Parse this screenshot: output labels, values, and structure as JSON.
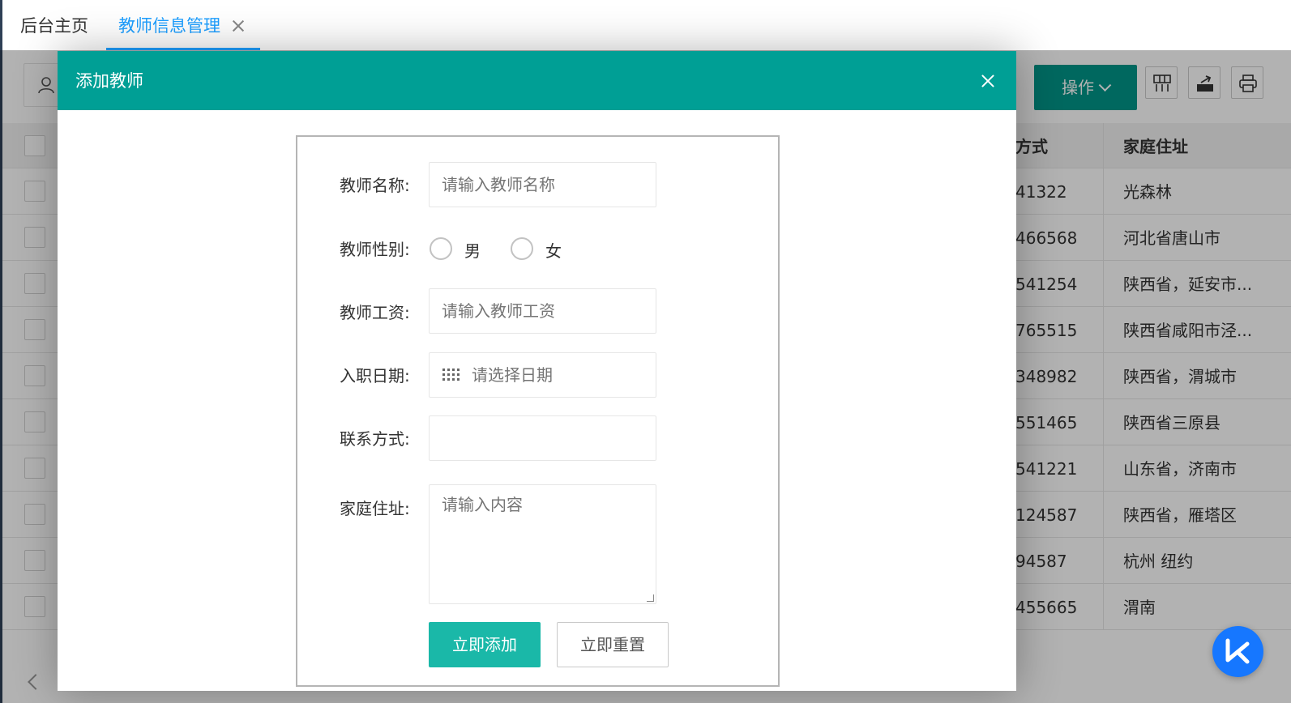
{
  "tabs": {
    "home_label": "后台主页",
    "active_label": "教师信息管理"
  },
  "toolbar": {
    "operate_label": "操作"
  },
  "table": {
    "headers": {
      "phone": "方式",
      "address": "家庭住址"
    },
    "rows": [
      {
        "phone": "41322",
        "address": "光森林"
      },
      {
        "phone": "466568",
        "address": "河北省唐山市"
      },
      {
        "phone": "541254",
        "address": "陕西省，延安市..."
      },
      {
        "phone": "765515",
        "address": "陕西省咸阳市泾..."
      },
      {
        "phone": "348982",
        "address": "陕西省，渭城市"
      },
      {
        "phone": "551465",
        "address": "陕西省三原县"
      },
      {
        "phone": "541221",
        "address": "山东省，济南市"
      },
      {
        "phone": "124587",
        "address": "陕西省，雁塔区"
      },
      {
        "phone": "94587",
        "address": "杭州 纽约"
      },
      {
        "phone": "455665",
        "address": "渭南"
      }
    ]
  },
  "modal": {
    "title": "添加教师",
    "form": {
      "name_label": "教师名称:",
      "name_placeholder": "请输入教师名称",
      "gender_label": "教师性别:",
      "gender_male": "男",
      "gender_female": "女",
      "salary_label": "教师工资:",
      "salary_placeholder": "请输入教师工资",
      "date_label": "入职日期:",
      "date_placeholder": "请选择日期",
      "contact_label": "联系方式:",
      "contact_value": "",
      "address_label": "家庭住址:",
      "address_placeholder": "请输入内容",
      "submit_label": "立即添加",
      "reset_label": "立即重置"
    }
  },
  "colors": {
    "modal_header": "#009f95",
    "submit_button": "#1ab8a8",
    "tab_active": "#1e9fff",
    "operate_button": "#009688"
  }
}
